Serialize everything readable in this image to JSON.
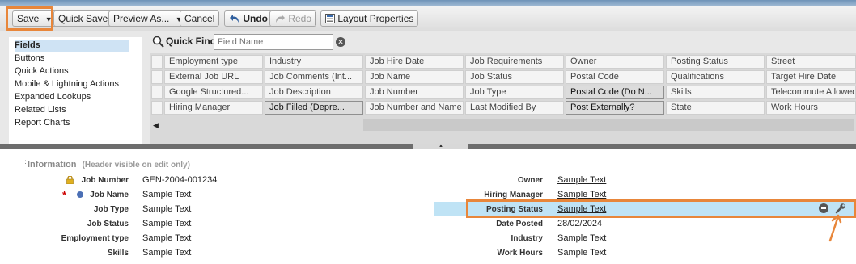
{
  "toolbar": {
    "save": "Save",
    "quick_save": "Quick Save",
    "preview_as": "Preview As...",
    "cancel": "Cancel",
    "undo": "Undo",
    "redo": "Redo",
    "layout_properties": "Layout Properties"
  },
  "sidebar": {
    "items": [
      "Fields",
      "Buttons",
      "Quick Actions",
      "Mobile & Lightning Actions",
      "Expanded Lookups",
      "Related Lists",
      "Report Charts"
    ],
    "selected": "Fields"
  },
  "quick_find": {
    "label": "Quick Find",
    "placeholder": "Field Name"
  },
  "field_palette": {
    "rows": [
      [
        "Employment type",
        "Industry",
        "Job Hire Date",
        "Job Requirements",
        "Owner",
        "Posting Status",
        "Street"
      ],
      [
        "External Job URL",
        "Job Comments (Int...",
        "Job Name",
        "Job Status",
        "Postal Code",
        "Qualifications",
        "Target Hire Date"
      ],
      [
        "Google Structured...",
        "Job Description",
        "Job Number",
        "Job Type",
        "Postal Code (Do N...",
        "Skills",
        "Telecommute Allowed"
      ],
      [
        "Hiring Manager",
        "Job Filled (Depre...",
        "Job Number and Name",
        "Last Modified By",
        "Post Externally?",
        "State",
        "Work Hours"
      ]
    ],
    "unused_highlighted": [
      "Job Filled (Depre...",
      "Postal Code (Do N...",
      "Post Externally?"
    ]
  },
  "section": {
    "title": "Information",
    "subtitle": "(Header visible on edit only)"
  },
  "left_fields": [
    {
      "label": "Job Number",
      "value": "GEN-2004-001234"
    },
    {
      "label": "Job Name",
      "value": "Sample Text"
    },
    {
      "label": "Job Type",
      "value": "Sample Text"
    },
    {
      "label": "Job Status",
      "value": "Sample Text"
    },
    {
      "label": "Employment type",
      "value": "Sample Text"
    },
    {
      "label": "Skills",
      "value": "Sample Text"
    }
  ],
  "right_fields": [
    {
      "label": "Owner",
      "value": "Sample Text"
    },
    {
      "label": "Hiring Manager",
      "value": "Sample Text"
    },
    {
      "label": "Posting Status",
      "value": "Sample Text"
    },
    {
      "label": "Date Posted",
      "value": "28/02/2024"
    },
    {
      "label": "Industry",
      "value": "Sample Text"
    },
    {
      "label": "Work Hours",
      "value": "Sample Text"
    }
  ],
  "colors": {
    "highlight_orange": "#e8863a",
    "selected_row": "#bfe3f5",
    "nav_selected": "#cfe3f4",
    "required_star": "#cc0000"
  },
  "icons": [
    "dropdown-caret-icon",
    "undo-icon",
    "redo-icon",
    "layout-properties-icon",
    "magnifier-icon",
    "clear-icon",
    "lock-icon",
    "required-dot-icon",
    "remove-icon",
    "wrench-icon",
    "arrow-annotation-icon"
  ]
}
